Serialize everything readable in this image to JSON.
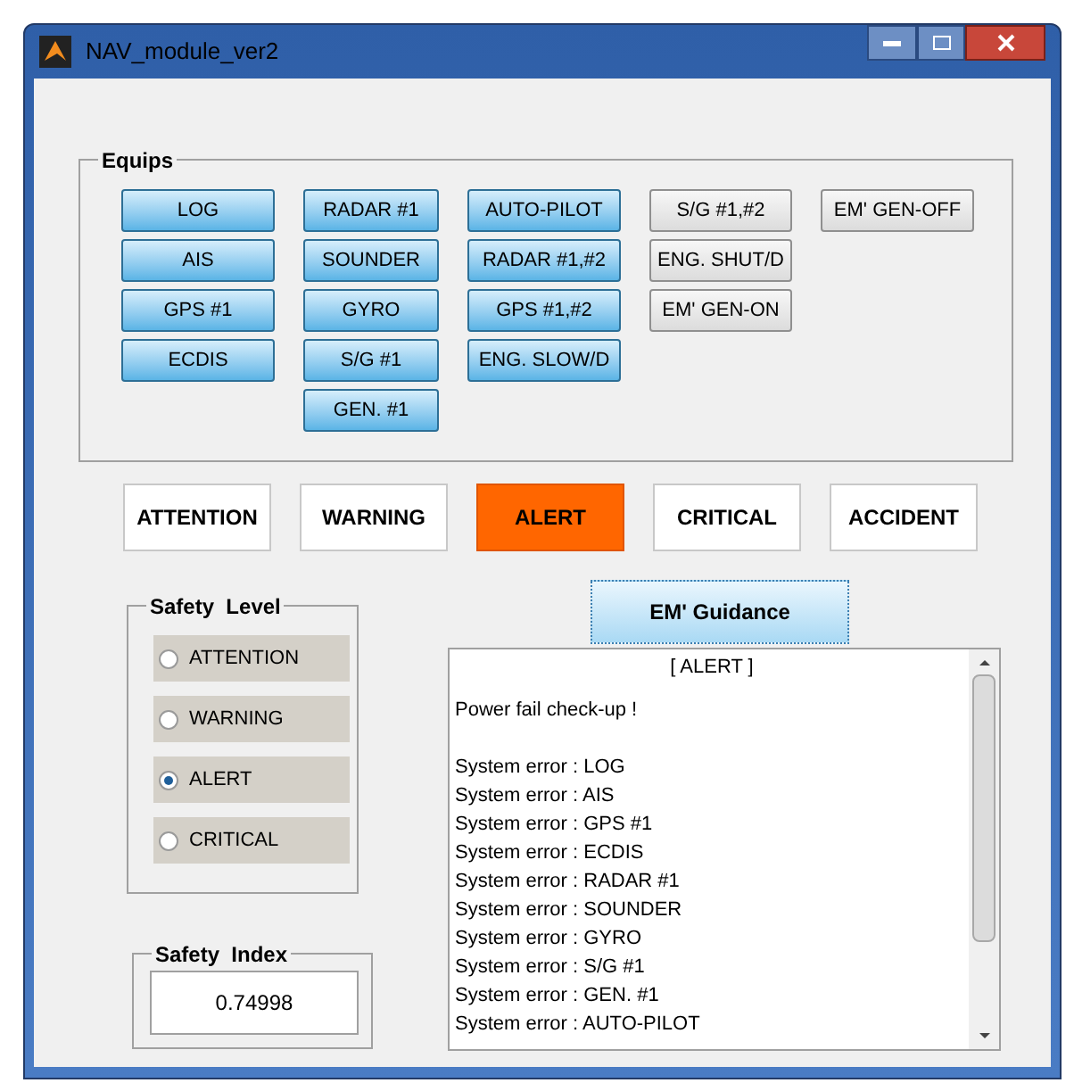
{
  "window": {
    "title": "NAV_module_ver2"
  },
  "equips": {
    "title": "Equips",
    "columns": [
      [
        {
          "label": "LOG",
          "active": true
        },
        {
          "label": "AIS",
          "active": true
        },
        {
          "label": "GPS #1",
          "active": true
        },
        {
          "label": "ECDIS",
          "active": true
        }
      ],
      [
        {
          "label": "RADAR #1",
          "active": true
        },
        {
          "label": "SOUNDER",
          "active": true
        },
        {
          "label": "GYRO",
          "active": true
        },
        {
          "label": "S/G #1",
          "active": true
        },
        {
          "label": "GEN. #1",
          "active": true
        }
      ],
      [
        {
          "label": "AUTO-PILOT",
          "active": true
        },
        {
          "label": "RADAR #1,#2",
          "active": true
        },
        {
          "label": "GPS #1,#2",
          "active": true
        },
        {
          "label": "ENG. SLOW/D",
          "active": true
        }
      ],
      [
        {
          "label": "S/G #1,#2",
          "active": false
        },
        {
          "label": "ENG. SHUT/D",
          "active": false
        },
        {
          "label": "EM' GEN-ON",
          "active": false
        }
      ],
      [
        {
          "label": "EM' GEN-OFF",
          "active": false
        }
      ]
    ]
  },
  "levels": [
    {
      "label": "ATTENTION",
      "selected": false
    },
    {
      "label": "WARNING",
      "selected": false
    },
    {
      "label": "ALERT",
      "selected": true
    },
    {
      "label": "CRITICAL",
      "selected": false
    },
    {
      "label": "ACCIDENT",
      "selected": false
    }
  ],
  "safety_level": {
    "title": "Safety  Level",
    "options": [
      {
        "label": "ATTENTION",
        "selected": false
      },
      {
        "label": "WARNING",
        "selected": false
      },
      {
        "label": "ALERT",
        "selected": true
      },
      {
        "label": "CRITICAL",
        "selected": false
      }
    ]
  },
  "safety_index": {
    "title": "Safety  Index",
    "value": "0.74998"
  },
  "guidance_button": "EM' Guidance",
  "log": {
    "heading": "[ ALERT ]",
    "note": "Power fail check-up !",
    "lines": [
      "System error : LOG",
      "System error : AIS",
      "System error : GPS #1",
      "System error : ECDIS",
      "System error : RADAR #1",
      "System error : SOUNDER",
      "System error : GYRO",
      "System error : S/G #1",
      "System error : GEN. #1",
      "System error : AUTO-PILOT"
    ]
  }
}
